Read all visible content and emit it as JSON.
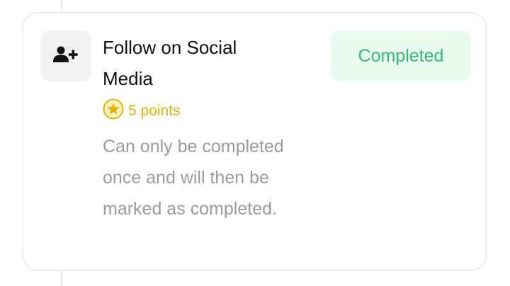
{
  "task": {
    "icon": "user-plus-icon",
    "title": "Follow on Social Media",
    "points_label": "5 points",
    "points_icon": "star-coin-icon",
    "description": "Can only be completed once and will then be marked as completed.",
    "status_label": "Completed"
  },
  "colors": {
    "points": "#e6b400",
    "status_text": "#35b97a",
    "status_bg": "#e8fbee",
    "description": "#9b9b9b"
  }
}
